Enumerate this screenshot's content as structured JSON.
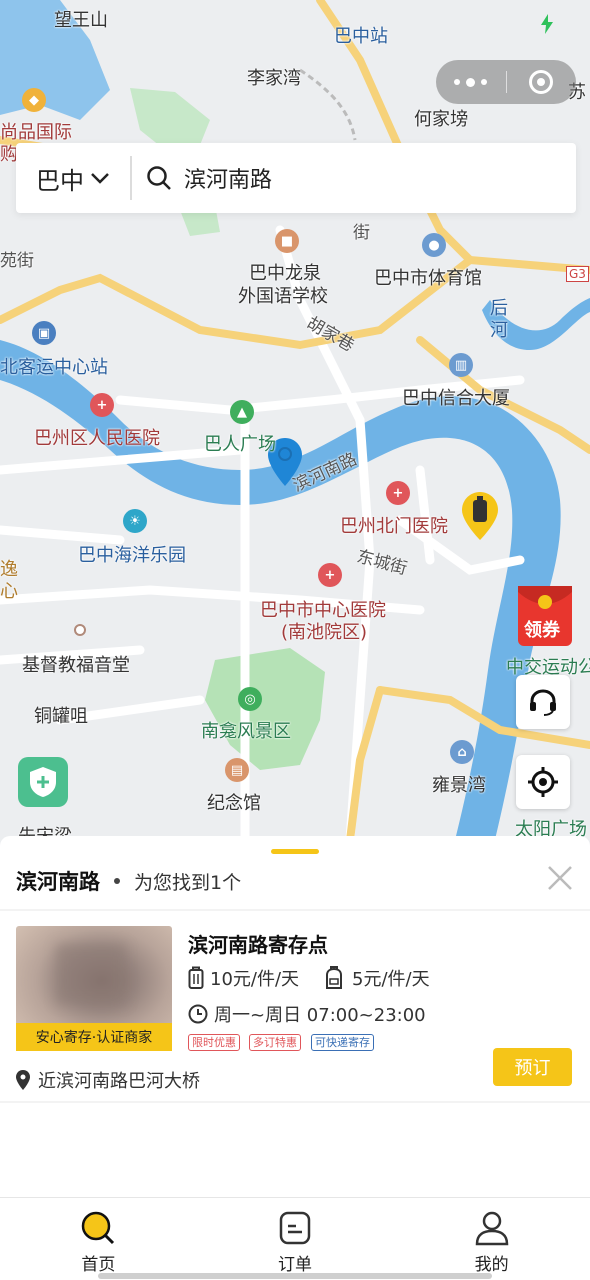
{
  "status_bar": {
    "place": "巴中站"
  },
  "search": {
    "city": "巴中",
    "query": "滨河南路"
  },
  "map": {
    "labels": {
      "wangwangshan": "望王山",
      "lijiawan": "李家湾",
      "bazhong_station": "巴中站",
      "hejiabang": "何家塝",
      "su": "苏",
      "shangpin": "尚品国际",
      "gou": "购",
      "lanjie": "苑街",
      "jie": "街",
      "longquan_1": "巴中龙泉",
      "longquan_2": "外国语学校",
      "tiyuguan": "巴中市体育馆",
      "g3": "G3",
      "houhe_1": "后",
      "houhe_2": "河",
      "hujiaxiang": "胡家巷",
      "keyun": "北客运中心站",
      "xinxin": "巴中信合大厦",
      "bazhou_hospital": "巴州区人民医院",
      "baren": "巴人广场",
      "binhe_road": "滨河南路",
      "beimen_hospital": "巴州北门医院",
      "haiyang": "巴中海洋乐园",
      "dongcheng": "东城街",
      "yi_1": "逸",
      "yi_2": "心",
      "center_hospital_1": "巴中市中心医院",
      "center_hospital_2": "(南池院区)",
      "zhongjiao": "中交运动公",
      "church": "基督教福音堂",
      "tongguan": "铜罐咀",
      "nankan": "南龛风景区",
      "yongjing": "雍景湾",
      "jinian": "纪念馆",
      "taiyang": "太阳广场",
      "xiansong": "先宋梁"
    },
    "coupon_label": "领券"
  },
  "sheet": {
    "title": "滨河南路",
    "count": "为您找到1个"
  },
  "result": {
    "name": "滨河南路寄存点",
    "thumb_tag": "安心寄存·认证商家",
    "price_large": "10元/件/天",
    "price_small": "5元/件/天",
    "hours": "周一~周日 07:00~23:00",
    "tags": [
      "限时优惠",
      "多订特惠",
      "可快递寄存"
    ],
    "address": "近滨河南路巴河大桥",
    "book_label": "预订"
  },
  "tabs": [
    {
      "label": "首页"
    },
    {
      "label": "订单"
    },
    {
      "label": "我的"
    }
  ],
  "colors": {
    "accent": "#f5c518",
    "river": "#6fb3e6",
    "road_major": "#f6d27a"
  }
}
